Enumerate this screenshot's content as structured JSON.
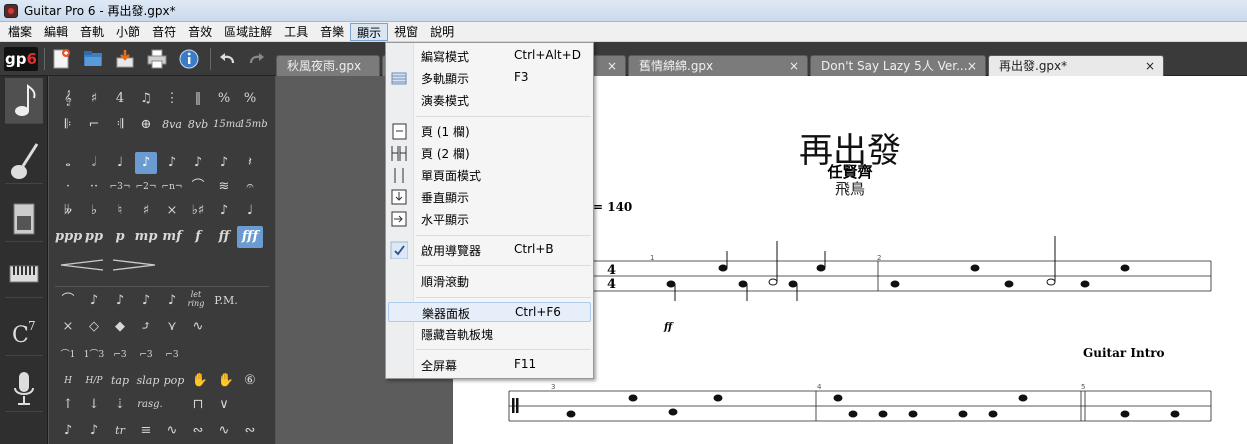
{
  "window": {
    "title": "Guitar Pro 6 - 再出發.gpx*"
  },
  "menubar": [
    "檔案",
    "編輯",
    "音軌",
    "小節",
    "音符",
    "音效",
    "區域註解",
    "工具",
    "音樂",
    "顯示",
    "視窗",
    "說明"
  ],
  "toolbar": {
    "logo_main": "gp",
    "logo_num": "6"
  },
  "tabs": [
    {
      "label": "秋風夜雨.gpx"
    },
    {
      "label": ""
    },
    {
      "label": "舊情綿綿.gpx"
    },
    {
      "label": "Don't Say Lazy 5人 Ver...."
    },
    {
      "label": "再出發.gpx*"
    }
  ],
  "tab_close": "×",
  "view_menu": {
    "items": [
      {
        "label": "編寫模式",
        "shortcut": "Ctrl+Alt+D",
        "icon": ""
      },
      {
        "label": "多軌顯示",
        "shortcut": "F3",
        "icon": "multitrack-icon"
      },
      {
        "label": "演奏模式",
        "shortcut": "",
        "icon": ""
      },
      {
        "label": "頁 (1 欄)",
        "shortcut": "",
        "icon": "page-one-column-icon"
      },
      {
        "label": "頁 (2 欄)",
        "shortcut": "",
        "icon": "page-two-column-icon"
      },
      {
        "label": "單頁面模式",
        "shortcut": "",
        "icon": "single-page-icon"
      },
      {
        "label": "垂直顯示",
        "shortcut": "",
        "icon": "vertical-view-icon"
      },
      {
        "label": "水平顯示",
        "shortcut": "",
        "icon": "horizontal-view-icon"
      },
      {
        "label": "啟用導覽器",
        "shortcut": "Ctrl+B",
        "icon": "checkmark-icon"
      },
      {
        "label": "順滑滾動",
        "shortcut": "",
        "icon": ""
      },
      {
        "label": "樂器面板",
        "shortcut": "Ctrl+F6",
        "icon": "",
        "highlighted": true
      },
      {
        "label": "隱藏音軌板塊",
        "shortcut": "",
        "icon": ""
      },
      {
        "label": "全屏幕",
        "shortcut": "F11",
        "icon": ""
      }
    ]
  },
  "palette": {
    "dynamics": [
      "ppp",
      "pp",
      "p",
      "mp",
      "mf",
      "f",
      "ff",
      "fff"
    ],
    "ottava": [
      "8va",
      "8vb",
      "15ma",
      "15mb"
    ],
    "techniques": [
      "let ring",
      "P.M.",
      "tap",
      "slap",
      "pop",
      "rasg.",
      "tr"
    ]
  },
  "score": {
    "title": "再出發",
    "artist": "任賢齊",
    "author": "飛鳥",
    "tempo": "= 140",
    "dynamic": "ff",
    "section": "Guitar Intro",
    "bar_numbers": [
      "1",
      "2",
      "3",
      "4",
      "5"
    ]
  },
  "colors": {
    "accent": "#6a9bd1",
    "panel": "#3b3b3b",
    "menu_hover": "#e6eefa"
  }
}
